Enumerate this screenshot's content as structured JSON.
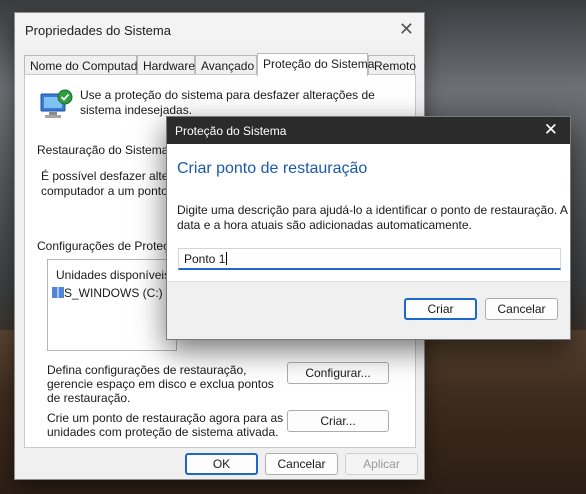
{
  "outer": {
    "title": "Propriedades do Sistema",
    "tabs": [
      {
        "label": "Nome do Computador"
      },
      {
        "label": "Hardware"
      },
      {
        "label": "Avançado"
      },
      {
        "label": "Proteção do Sistema"
      },
      {
        "label": "Remoto"
      }
    ],
    "intro": "Use a proteção do sistema para desfazer alterações de sistema indesejadas.",
    "restore_heading": "Restauração do Sistema",
    "restore_text": "É possível desfazer alterações do sistema revertendo seu computador a um ponto de restauração anterior.",
    "config_heading": "Configurações de Proteção",
    "drives_header": "Unidades disponíveis",
    "drive_name": "S_WINDOWS (C:) (Sistema)",
    "configure_text": "Defina configurações de restauração, gerencie espaço em disco e exclua pontos de restauração.",
    "configure_button": "Configurar...",
    "create_text": "Crie um ponto de restauração agora para as unidades com proteção de sistema ativada.",
    "create_button": "Criar...",
    "ok_button": "OK",
    "cancel_button": "Cancelar",
    "apply_button": "Aplicar"
  },
  "inner": {
    "title": "Proteção do Sistema",
    "heading": "Criar ponto de restauração",
    "description": "Digite uma descrição para ajudá-lo a identificar o ponto de restauração. A data e a hora atuais são adicionadas automaticamente.",
    "input_value": "Ponto 1",
    "create_button": "Criar",
    "cancel_button": "Cancelar"
  },
  "colors": {
    "accent": "#1b6ac9",
    "dialog_titlebar": "#2b2b2b"
  }
}
